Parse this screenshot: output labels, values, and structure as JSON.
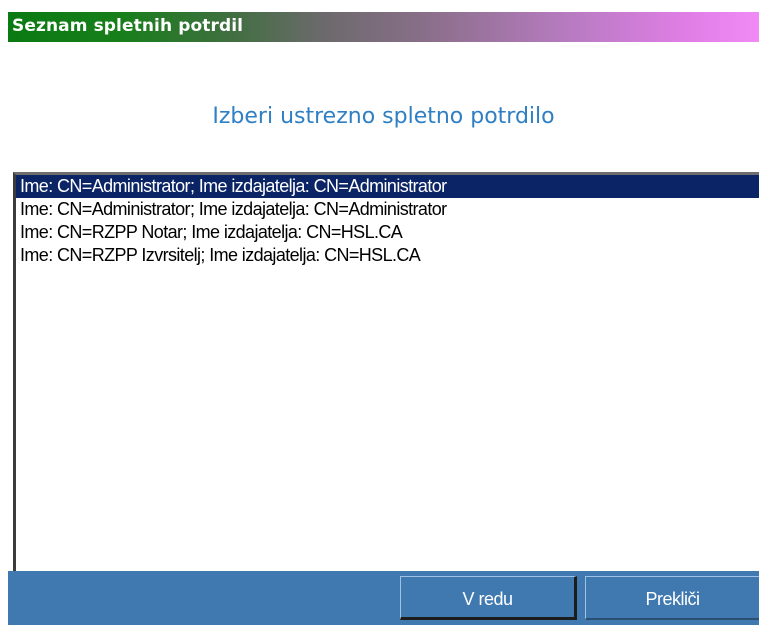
{
  "window": {
    "title": "Seznam spletnih potrdil"
  },
  "heading": "Izberi ustrezno spletno potrdilo",
  "certificates": [
    {
      "label": "Ime: CN=Administrator; Ime izdajatelja: CN=Administrator",
      "selected": true
    },
    {
      "label": "Ime: CN=Administrator; Ime izdajatelja: CN=Administrator",
      "selected": false
    },
    {
      "label": "Ime: CN=RZPP Notar; Ime izdajatelja: CN=HSL.CA",
      "selected": false
    },
    {
      "label": "Ime: CN=RZPP Izvrsitelj; Ime izdajatelja: CN=HSL.CA",
      "selected": false
    }
  ],
  "buttons": {
    "ok_label": "V redu",
    "cancel_label": "Prekliči"
  },
  "colors": {
    "title_gradient_start": "#0a7a12",
    "title_gradient_end": "#f18af5",
    "heading": "#2f7fc4",
    "selection": "#0a2466",
    "footer": "#3f79b0"
  }
}
